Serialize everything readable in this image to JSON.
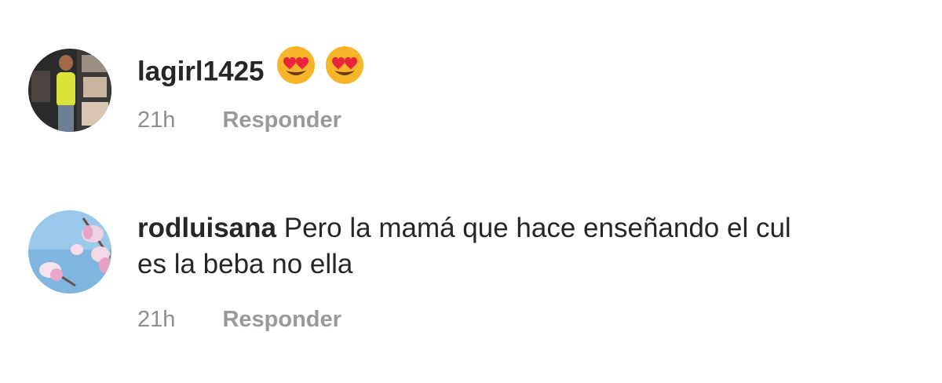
{
  "comments": [
    {
      "username": "lagirl1425",
      "text": "",
      "emojis": [
        "smiling-face-with-heart-eyes",
        "smiling-face-with-heart-eyes"
      ],
      "time": "21h",
      "reply_label": "Responder"
    },
    {
      "username": "rodluisana",
      "text": "Pero la mamá que hace enseñando el cul",
      "text_line2": "es la beba no ella",
      "time": "21h",
      "reply_label": "Responder"
    }
  ],
  "colors": {
    "primary_text": "#262626",
    "secondary_text": "#8e8e8e",
    "emoji_face": "#f7b52a",
    "emoji_heart": "#e8253c"
  }
}
